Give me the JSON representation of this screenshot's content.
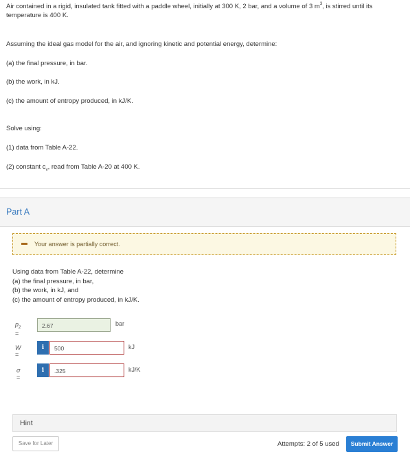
{
  "problem": {
    "intro_before_sup": "Air contained in a rigid, insulated tank fitted with a paddle wheel, initially at 300 K, 2 bar, and a volume of 3 m",
    "intro_sup": "3",
    "intro_after_sup": ", is stirred until its temperature is 400 K.",
    "assumption": "Assuming the ideal gas model for the air, and ignoring kinetic and potential energy, determine:",
    "item_a": "(a) the final pressure, in bar.",
    "item_b": "(b) the work, in kJ.",
    "item_c": "(c) the amount of entropy produced, in kJ/K.",
    "solve_using": "Solve using:",
    "method_1": "(1) data from Table A-22.",
    "method_2_before_sub": "(2) constant c",
    "method_2_sub": "v",
    "method_2_after_sub": ", read from Table A-20 at 400 K."
  },
  "part": {
    "title": "Part A",
    "alert": "Your answer is partially correct.",
    "instructions": [
      "Using data from Table A-22, determine",
      "(a) the final pressure, in bar,",
      "(b) the work, in kJ, and",
      "(c) the amount of entropy produced, in kJ/K."
    ]
  },
  "answers": {
    "p2": {
      "var": "p",
      "sub": "2",
      "eq": " =",
      "value": "2.67",
      "unit": "bar"
    },
    "W": {
      "var": "W",
      "eq": " =",
      "info": "i",
      "value": "500",
      "unit": "kJ"
    },
    "sigma": {
      "var": "σ",
      "eq": " =",
      "info": "i",
      "value": ".325",
      "unit": "kJ/K"
    }
  },
  "hint_label": "Hint",
  "save_label": "Save for Later",
  "attempts_text": "Attempts: 2 of 5 used",
  "submit_label": "Submit Answer",
  "colors": {
    "link_blue": "#3a7bbf",
    "submit_blue": "#2a7fd4",
    "error_red": "#b03a3a",
    "warning_bg": "#fcf8e3"
  }
}
